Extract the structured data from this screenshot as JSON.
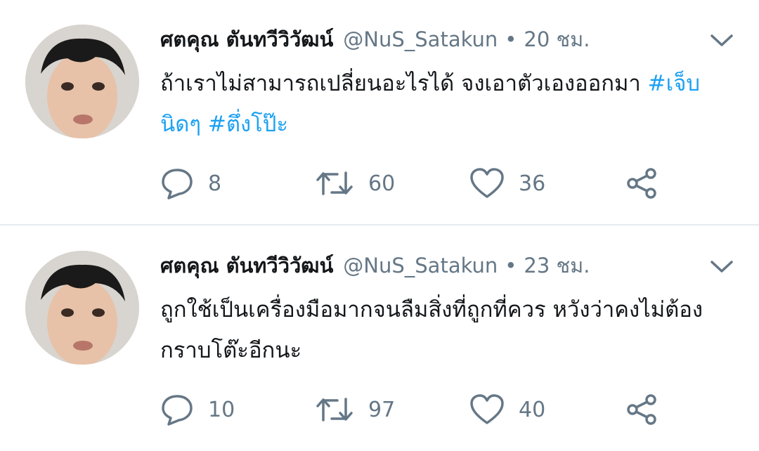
{
  "tweets": [
    {
      "name": "ศตคุณ ตันทวีวิวัฒน์",
      "handle": "@NuS_Satakun",
      "separator": "•",
      "time": "20 ชม.",
      "text": "ถ้าเราไม่สามารถเปลี่ยนอะไรได้ จงเอาตัวเองออกมา ",
      "hashtags": [
        "#เจ็บนิดๆ",
        "#ตึ่งโป๊ะ"
      ],
      "replies": "8",
      "retweets": "60",
      "likes": "36"
    },
    {
      "name": "ศตคุณ ตันทวีวิวัฒน์",
      "handle": "@NuS_Satakun",
      "separator": "•",
      "time": "23 ชม.",
      "text": "ถูกใช้เป็นเครื่องมือมากจนลืมสิ่งที่ถูกที่ควร หวังว่าคงไม่ต้องกราบโต๊ะอีกนะ",
      "hashtags": [],
      "replies": "10",
      "retweets": "97",
      "likes": "40"
    }
  ],
  "colors": {
    "hashtag": "#1da1f2",
    "secondary_text": "#657786",
    "icon": "#657786",
    "divider": "#e6ecf0"
  },
  "icons": [
    "reply-icon",
    "retweet-icon",
    "like-icon",
    "share-icon",
    "chevron-down-icon"
  ]
}
